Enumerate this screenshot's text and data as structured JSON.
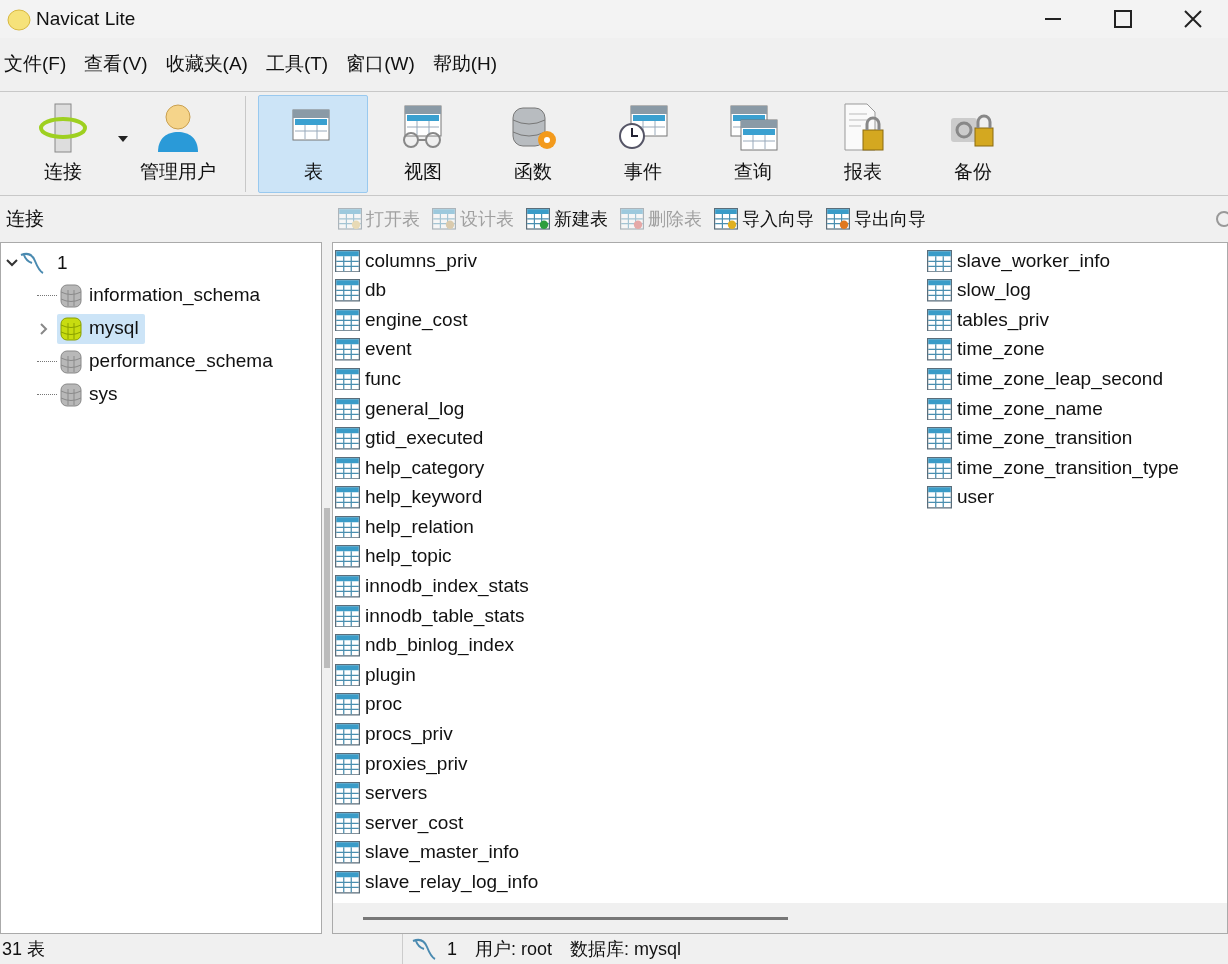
{
  "window": {
    "title": "Navicat Lite"
  },
  "menu": [
    "文件(F)",
    "查看(V)",
    "收藏夹(A)",
    "工具(T)",
    "窗口(W)",
    "帮助(H)"
  ],
  "toolbar": [
    {
      "kind": "connect",
      "label": "连接",
      "selected": false
    },
    {
      "kind": "user",
      "label": "管理用户",
      "selected": false
    },
    {
      "kind": "table",
      "label": "表",
      "selected": true
    },
    {
      "kind": "view",
      "label": "视图",
      "selected": false
    },
    {
      "kind": "function",
      "label": "函数",
      "selected": false
    },
    {
      "kind": "event",
      "label": "事件",
      "selected": false
    },
    {
      "kind": "query",
      "label": "查询",
      "selected": false
    },
    {
      "kind": "report",
      "label": "报表",
      "selected": false
    },
    {
      "kind": "backup",
      "label": "备份",
      "selected": false
    }
  ],
  "connections_label": "连接",
  "actions": [
    {
      "label": "打开表",
      "disabled": true,
      "kind": "open"
    },
    {
      "label": "设计表",
      "disabled": true,
      "kind": "design"
    },
    {
      "label": "新建表",
      "disabled": false,
      "kind": "new"
    },
    {
      "label": "删除表",
      "disabled": true,
      "kind": "delete"
    },
    {
      "label": "导入向导",
      "disabled": false,
      "kind": "import"
    },
    {
      "label": "导出向导",
      "disabled": false,
      "kind": "export"
    }
  ],
  "tree": [
    {
      "label": "1",
      "expanded": true,
      "children": [
        {
          "label": "information_schema",
          "selected": false,
          "open": false
        },
        {
          "label": "mysql",
          "selected": true,
          "open": true,
          "expanded": false
        },
        {
          "label": "performance_schema",
          "selected": false,
          "open": false
        },
        {
          "label": "sys",
          "selected": false,
          "open": false
        }
      ]
    }
  ],
  "tables": [
    "columns_priv",
    "db",
    "engine_cost",
    "event",
    "func",
    "general_log",
    "gtid_executed",
    "help_category",
    "help_keyword",
    "help_relation",
    "help_topic",
    "innodb_index_stats",
    "innodb_table_stats",
    "ndb_binlog_index",
    "plugin",
    "proc",
    "procs_priv",
    "proxies_priv",
    "servers",
    "server_cost",
    "slave_master_info",
    "slave_relay_log_info",
    "slave_worker_info",
    "slow_log",
    "tables_priv",
    "time_zone",
    "time_zone_leap_second",
    "time_zone_name",
    "time_zone_transition",
    "time_zone_transition_type",
    "user"
  ],
  "status_bar": {
    "count": "31 表",
    "connection": "1",
    "user": "用户: root",
    "database": "数据库: mysql"
  }
}
